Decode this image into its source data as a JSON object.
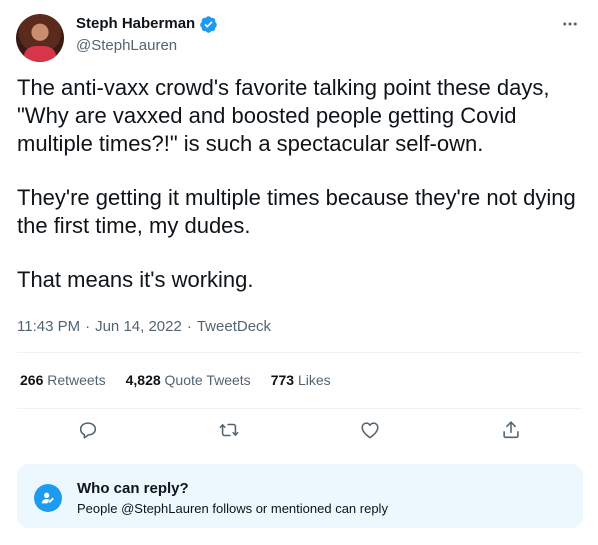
{
  "author": {
    "display_name": "Steph Haberman",
    "handle": "@StephLauren",
    "verified": true,
    "avatar_icon": "profile-photo"
  },
  "tweet": {
    "paragraphs": [
      "The anti-vaxx crowd's favorite talking point these days, \"Why are vaxxed and boosted people getting Covid multiple times?!\" is such a spectacular self-own.",
      "They're getting it multiple times because they're not dying the first time, my dudes.",
      "That means it's working."
    ],
    "time": "11:43 PM",
    "date": "Jun 14, 2022",
    "source": "TweetDeck",
    "separator": "·"
  },
  "stats": {
    "retweets": {
      "count": "266",
      "label": "Retweets"
    },
    "quote_tweets": {
      "count": "4,828",
      "label": "Quote Tweets"
    },
    "likes": {
      "count": "773",
      "label": "Likes"
    }
  },
  "actions": [
    "reply-icon",
    "retweet-icon",
    "like-icon",
    "share-icon"
  ],
  "reply_settings": {
    "title": "Who can reply?",
    "description": "People @StephLauren follows or mentioned can reply"
  },
  "colors": {
    "accent": "#1d9bf0",
    "secondary_text": "#536471",
    "reply_box_bg": "#ecf8fe"
  }
}
